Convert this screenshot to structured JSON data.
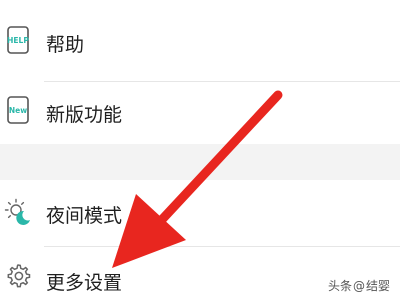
{
  "menu": {
    "items": [
      {
        "label": "帮助",
        "icon": "help-phone-icon",
        "icon_text": "HELP"
      },
      {
        "label": "新版功能",
        "icon": "new-phone-icon",
        "icon_text": "New"
      },
      {
        "label": "夜间模式",
        "icon": "night-mode-icon"
      },
      {
        "label": "更多设置",
        "icon": "gear-icon"
      }
    ]
  },
  "watermark": {
    "source": "头条",
    "at": "@",
    "author": "结婴"
  },
  "colors": {
    "accent_icon": "#2ab7a9",
    "arrow": "#e8261f",
    "section_gap": "#f3f3f3"
  }
}
